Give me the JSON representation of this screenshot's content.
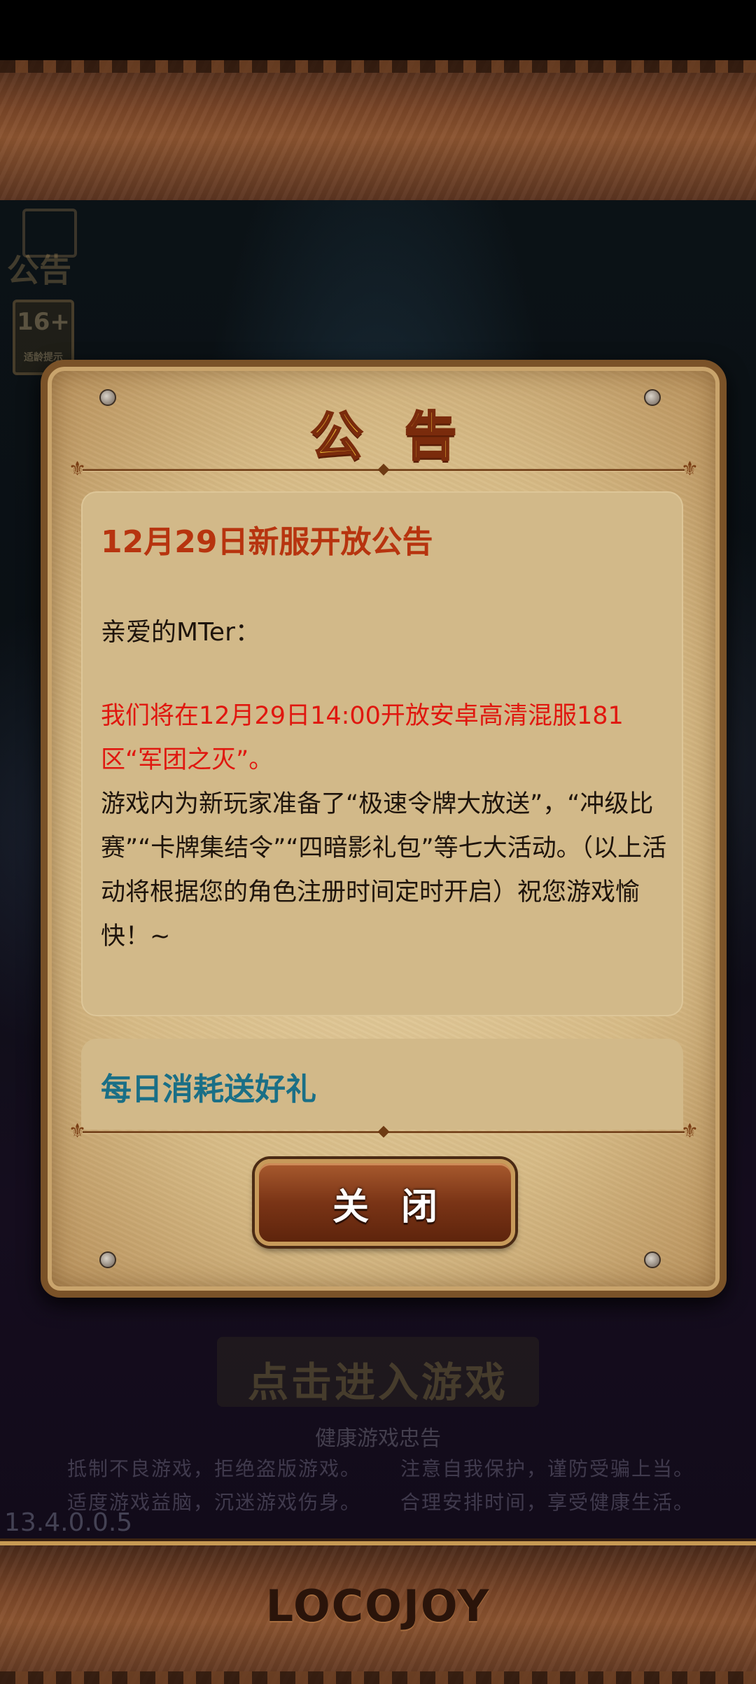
{
  "background": {
    "side_icon_label": "公告",
    "age_badge": {
      "rating": "16+",
      "caption": "适龄提示"
    },
    "enter_button_label": "点击进入游戏",
    "health_notice": {
      "title": "健康游戏忠告",
      "left_lines": [
        "抵制不良游戏，拒绝盗版游戏。",
        "适度游戏益脑，沉迷游戏伤身。"
      ],
      "right_lines": [
        "注意自我保护，谨防受骗上当。",
        "合理安排时间，享受健康生活。"
      ]
    },
    "version": "13.4.0.0.5",
    "logo_text": "LOCOJOY"
  },
  "dialog": {
    "title": "公告",
    "announcement": {
      "title": "12月29日新服开放公告",
      "greeting": "亲爱的MTer：",
      "highlight": "我们将在12月29日14:00开放安卓高清混服181区“军团之灭”。",
      "body": "游戏内为新玩家准备了“极速令牌大放送”，“冲级比赛”“卡牌集结令”“四暗影礼包”等七大活动。（以上活动将根据您的角色注册时间定时开启）祝您游戏愉快！~"
    },
    "next_item_title": "每日消耗送好礼",
    "close_button_label": "关闭"
  },
  "colors": {
    "title_gold": "#f7c83a",
    "announcement_title": "#b7340f",
    "highlight_red": "#e0170f",
    "next_item_teal": "#1a6f86"
  }
}
